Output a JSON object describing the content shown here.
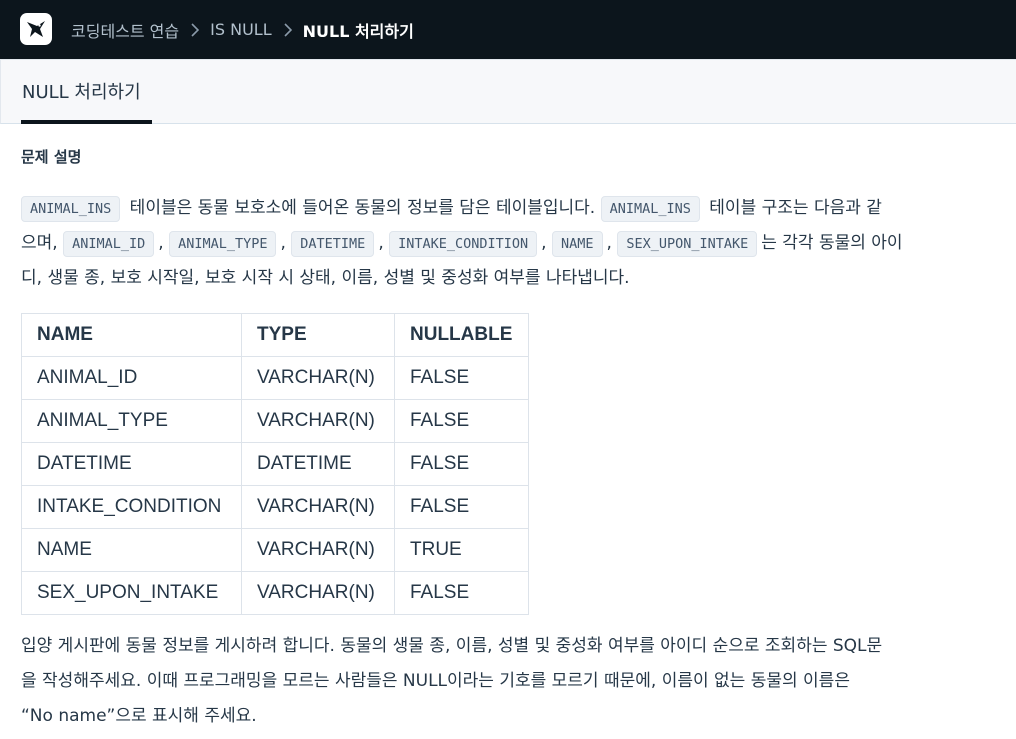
{
  "header": {
    "logo_icon": "programmers-bird-icon",
    "breadcrumbs": [
      "코딩테스트 연습",
      "IS NULL",
      "NULL 처리하기"
    ]
  },
  "tab": {
    "label": "NULL 처리하기"
  },
  "problem": {
    "section_title": "문제 설명",
    "intro_lines": [
      [
        {
          "code": "ANIMAL_INS"
        },
        {
          "text": " 테이블은 동물 보호소에 들어온 동물의 정보를 담은 테이블입니다. "
        },
        {
          "code": "ANIMAL_INS"
        },
        {
          "text": " 테이블 구조는 다음과 같"
        }
      ],
      [
        {
          "text": "으며, "
        },
        {
          "code": "ANIMAL_ID"
        },
        {
          "text": ", "
        },
        {
          "code": "ANIMAL_TYPE"
        },
        {
          "text": ", "
        },
        {
          "code": "DATETIME"
        },
        {
          "text": ", "
        },
        {
          "code": "INTAKE_CONDITION"
        },
        {
          "text": ", "
        },
        {
          "code": "NAME"
        },
        {
          "text": ", "
        },
        {
          "code": "SEX_UPON_INTAKE"
        },
        {
          "text": "는 각각 동물의 아이"
        }
      ],
      [
        {
          "text": "디, 생물 종, 보호 시작일, 보호 시작 시 상태, 이름, 성별 및 중성화 여부를 나타냅니다."
        }
      ]
    ],
    "table": {
      "headers": [
        "NAME",
        "TYPE",
        "NULLABLE"
      ],
      "rows": [
        [
          "ANIMAL_ID",
          "VARCHAR(N)",
          "FALSE"
        ],
        [
          "ANIMAL_TYPE",
          "VARCHAR(N)",
          "FALSE"
        ],
        [
          "DATETIME",
          "DATETIME",
          "FALSE"
        ],
        [
          "INTAKE_CONDITION",
          "VARCHAR(N)",
          "FALSE"
        ],
        [
          "NAME",
          "VARCHAR(N)",
          "TRUE"
        ],
        [
          "SEX_UPON_INTAKE",
          "VARCHAR(N)",
          "FALSE"
        ]
      ]
    },
    "task_lines": [
      "입양 게시판에 동물 정보를 게시하려 합니다. 동물의 생물 종, 이름, 성별 및 중성화 여부를 아이디 순으로 조회하는 SQL문",
      "을 작성해주세요. 이때 프로그래밍을 모르는 사람들은 NULL이라는 기호를 모르기 때문에, 이름이 없는 동물의 이름은",
      "“No name”으로 표시해 주세요."
    ]
  }
}
